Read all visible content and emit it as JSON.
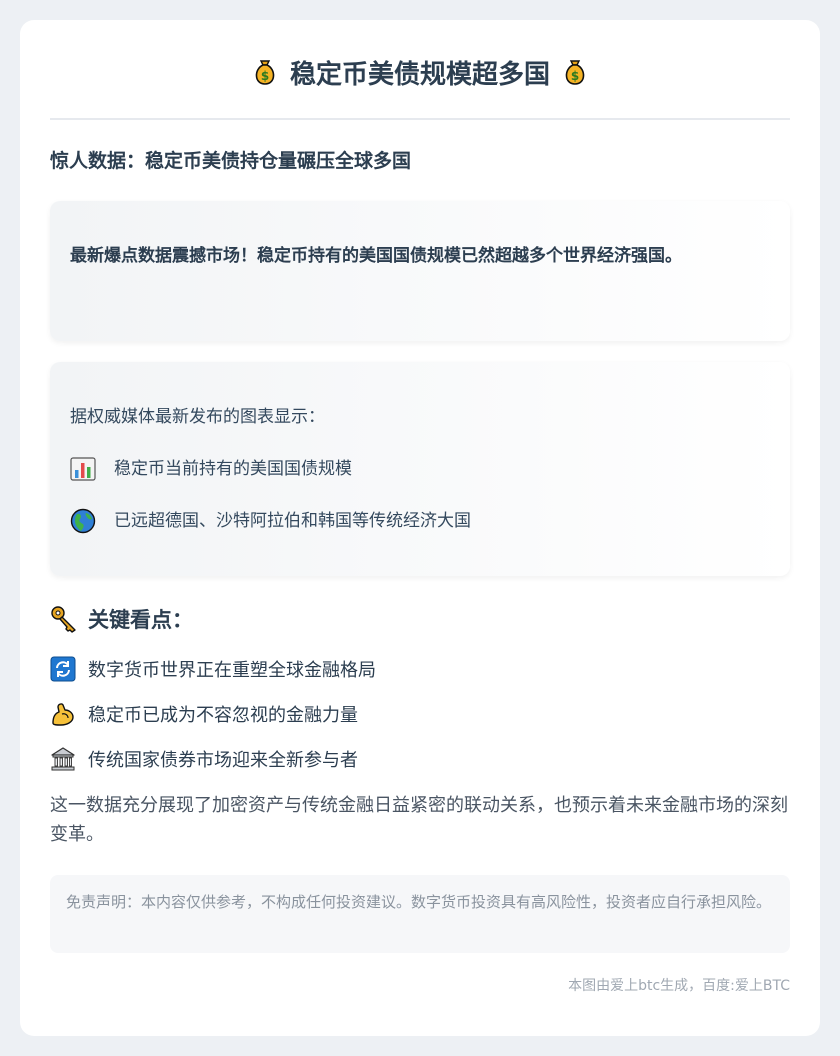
{
  "header": {
    "title": "稳定币美债规模超多国",
    "icon_left": "money-bag-icon",
    "icon_right": "money-bag-icon"
  },
  "subtitle": "惊人数据：稳定币美债持仓量碾压全球多国",
  "highlight": {
    "text": "最新爆点数据震撼市场！稳定币持有的美国国债规模已然超越多个世界经济强国。"
  },
  "source": {
    "intro": "据权威媒体最新发布的图表显示：",
    "items": [
      {
        "icon": "bar-chart-icon",
        "text": "稳定币当前持有的美国国债规模"
      },
      {
        "icon": "globe-icon",
        "text": "已远超德国、沙特阿拉伯和韩国等传统经济大国"
      }
    ]
  },
  "key_points": {
    "heading": "关键看点：",
    "heading_icon": "key-icon",
    "items": [
      {
        "icon": "refresh-icon",
        "text": "数字货币世界正在重塑全球金融格局"
      },
      {
        "icon": "flexed-biceps-icon",
        "text": "稳定币已成为不容忽视的金融力量"
      },
      {
        "icon": "bank-icon",
        "text": "传统国家债券市场迎来全新参与者"
      }
    ]
  },
  "summary": "这一数据充分展现了加密资产与传统金融日益紧密的联动关系，也预示着未来金融市场的深刻变革。",
  "disclaimer": "免责声明：本内容仅供参考，不构成任何投资建议。数字货币投资具有高风险性，投资者应自行承担风险。",
  "footer": "本图由爱上btc生成，百度:爱上BTC",
  "colors": {
    "background": "#edf0f4",
    "card": "#ffffff",
    "text": "#2c3e50",
    "muted": "#8a939e"
  }
}
